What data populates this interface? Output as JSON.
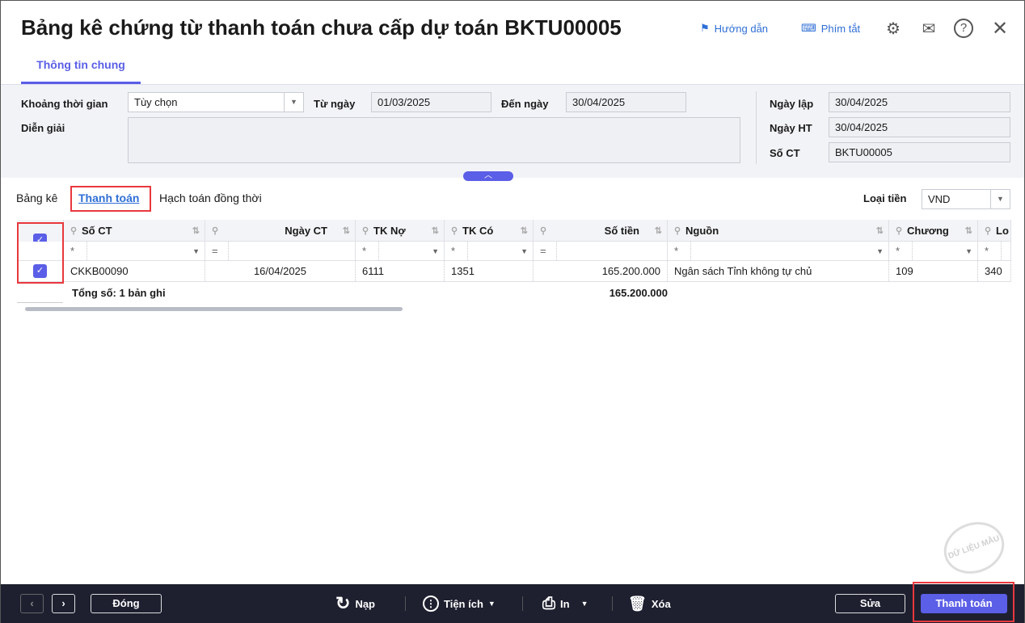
{
  "header": {
    "title": "Bảng kê chứng từ thanh toán chưa cấp dự toán BKTU00005",
    "guide": "Hướng dẫn",
    "shortcuts": "Phím tắt"
  },
  "tabs": [
    {
      "label": "Thông tin chung"
    }
  ],
  "form": {
    "period_label": "Khoảng thời gian",
    "period_value": "Tùy chọn",
    "from_label": "Từ ngày",
    "from_value": "01/03/2025",
    "to_label": "Đến ngày",
    "to_value": "30/04/2025",
    "desc_label": "Diễn giải",
    "desc_value": "",
    "created_label": "Ngày lập",
    "created_value": "30/04/2025",
    "ht_label": "Ngày HT",
    "ht_value": "30/04/2025",
    "ct_label": "Số CT",
    "ct_value": "BKTU00005"
  },
  "subtabs": [
    "Bảng kê",
    "Thanh toán",
    "Hạch toán đồng thời"
  ],
  "currency": {
    "label": "Loại tiền",
    "value": "VND"
  },
  "grid": {
    "columns": [
      "Số CT",
      "Ngày CT",
      "TK Nợ",
      "TK Có",
      "Số tiền",
      "Nguồn",
      "Chương",
      "Lo"
    ],
    "filters": [
      "*",
      "=",
      "*",
      "*",
      "=",
      "*",
      "*",
      "*"
    ],
    "rows": [
      {
        "checked": true,
        "cells": [
          "CKKB00090",
          "16/04/2025",
          "6111",
          "1351",
          "165.200.000",
          "Ngân sách Tỉnh không tự chủ",
          "109",
          "340"
        ]
      }
    ],
    "total_prefix": "Tổng số:",
    "total_count": "1",
    "total_suffix": "bản ghi",
    "total_amount": "165.200.000"
  },
  "watermark": "DỮ LIỆU MẪU",
  "footer": {
    "close": "Đóng",
    "reload": "Nạp",
    "utilities": "Tiện ích",
    "print": "In",
    "delete": "Xóa",
    "edit": "Sửa",
    "pay": "Thanh toán"
  },
  "colors": {
    "accent": "#5b5ee6",
    "highlight": "#e8383d",
    "footer_bg": "#1e2030"
  }
}
